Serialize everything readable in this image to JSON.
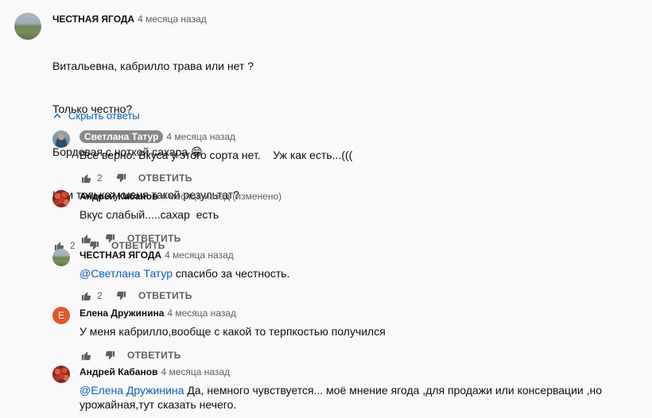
{
  "comment": {
    "author": "ЧЕСТНАЯ ЯГОДА",
    "time": "4 месяца назад",
    "lines": [
      "Витальевна, кабрилло трава или нет ?",
      "Только честно?",
      "Бордовая с ноткой сахара 😁",
      "Или только у меня такой результат?"
    ],
    "likes": "2",
    "reply_label": "ОТВЕТИТЬ"
  },
  "hide_replies_label": "Скрыть ответы",
  "replies": [
    {
      "author": "Светлана Татур",
      "time": "4 месяца назад",
      "text": "Все верно. Вкуса у этого сорта нет.    Уж как есть...(((",
      "likes": "2",
      "reply_label": "ОТВЕТИТЬ"
    },
    {
      "author": "Андрей Кабанов",
      "time": "4 месяца назад (изменено)",
      "text": "Вкус слабый.....сахар  есть",
      "likes": "",
      "reply_label": "ОТВЕТИТЬ"
    },
    {
      "author": "ЧЕСТНАЯ ЯГОДА",
      "time": "4 месяца назад",
      "mention": "@Светлана Татур",
      "text": " спасибо за честность.",
      "likes": "2",
      "reply_label": "ОТВЕТИТЬ"
    },
    {
      "author": "Елена Дружинина",
      "avatar_letter": "E",
      "time": "4 месяца назад",
      "text": "У меня кабрилло,вообще с какой то терпкостью получился",
      "likes": "",
      "reply_label": "ОТВЕТИТЬ"
    },
    {
      "author": "Андрей Кабанов",
      "time": "4 месяца назад",
      "mention": "@Елена Дружинина",
      "text": " Да, немного чувствуется... моё мнение ягода ,для продажи или консервации ,но урожайная,тут сказать нечего.",
      "likes": "",
      "reply_label": "ОТВЕТИТЬ"
    }
  ],
  "icons": {
    "like": "thumb-up-icon",
    "dislike": "thumb-down-icon",
    "collapse": "chevron-up-icon"
  },
  "colors": {
    "link": "#065fd4",
    "secondary_text": "#606060",
    "background": "#f9f9f9"
  }
}
